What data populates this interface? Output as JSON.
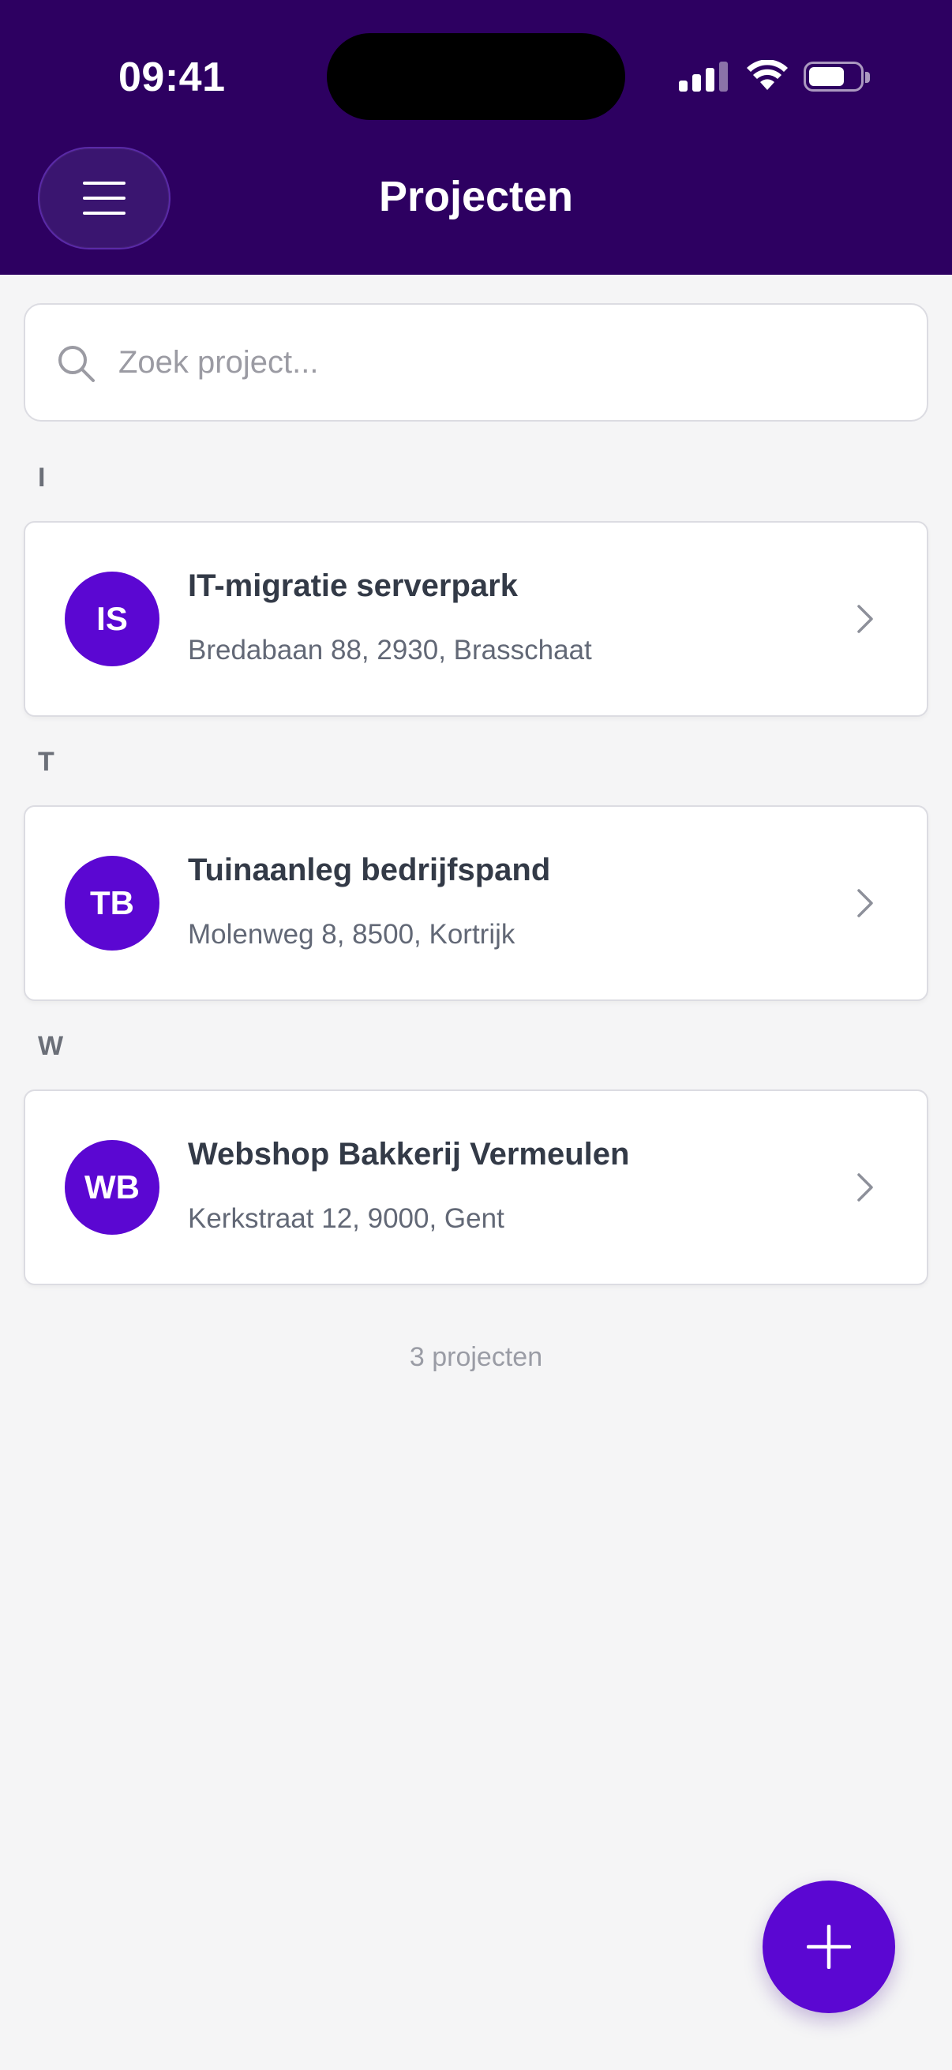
{
  "status_bar": {
    "time": "09:41"
  },
  "header": {
    "title": "Projecten",
    "menu_icon": "hamburger-icon"
  },
  "search": {
    "placeholder": "Zoek project...",
    "value": "",
    "icon": "search-icon"
  },
  "sections": [
    {
      "letter": "I",
      "projects": [
        {
          "initials": "IS",
          "name": "IT-migratie serverpark",
          "address": "Bredabaan 88, 2930, Brasschaat"
        }
      ]
    },
    {
      "letter": "T",
      "projects": [
        {
          "initials": "TB",
          "name": "Tuinaanleg bedrijfspand",
          "address": "Molenweg 8, 8500, Kortrijk"
        }
      ]
    },
    {
      "letter": "W",
      "projects": [
        {
          "initials": "WB",
          "name": "Webshop Bakkerij Vermeulen",
          "address": "Kerkstraat 12, 9000, Gent"
        }
      ]
    }
  ],
  "footer": {
    "count_label": "3 projecten"
  },
  "fab": {
    "icon": "plus-icon"
  },
  "colors": {
    "header_bg": "#2d0061",
    "accent": "#5b07d2",
    "page_bg": "#f5f5f6"
  }
}
